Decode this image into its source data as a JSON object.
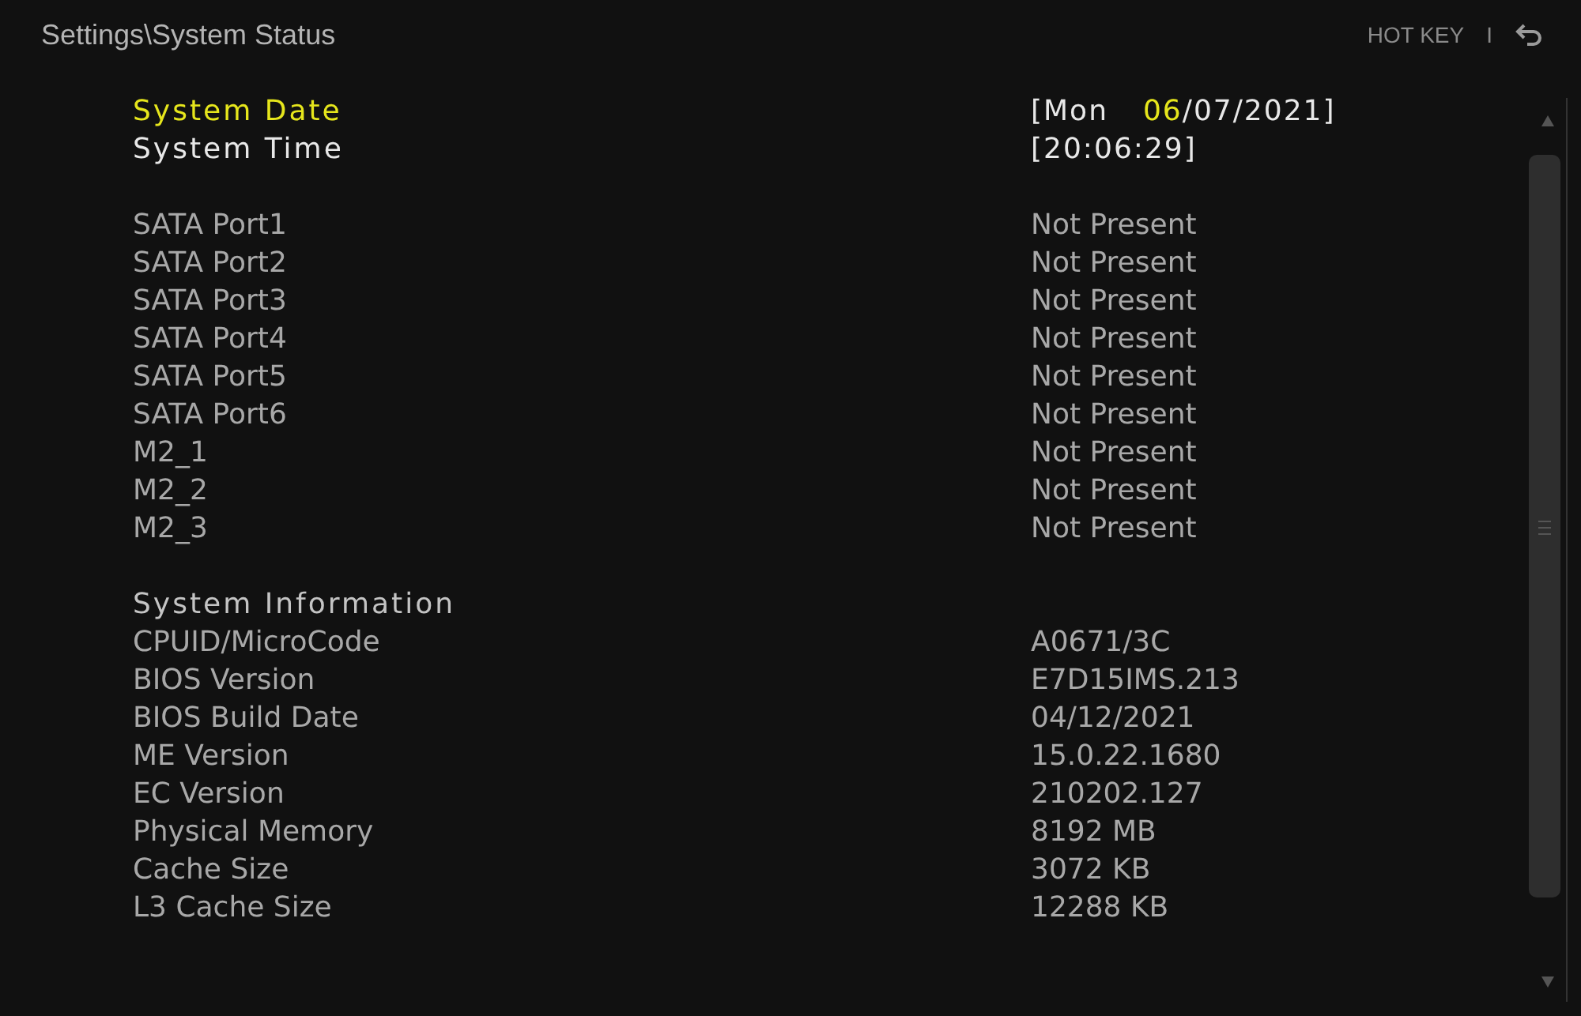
{
  "header": {
    "breadcrumb": "Settings\\System Status",
    "hotkey": "HOT KEY",
    "separator": "I"
  },
  "groups": [
    {
      "rows": [
        {
          "label": "System Date",
          "kind": "editable",
          "selected": true,
          "value_parts": [
            {
              "text": "[Mon",
              "selected": false
            },
            {
              "text": "06",
              "selected": true
            },
            {
              "text": "/07/2021]",
              "selected": false
            }
          ]
        },
        {
          "label": "System Time",
          "kind": "editable",
          "selected": false,
          "value_parts": [
            {
              "text": "[20:06:29]",
              "selected": false
            }
          ]
        }
      ]
    },
    {
      "rows": [
        {
          "label": "SATA Port1",
          "kind": "info",
          "value": "Not Present"
        },
        {
          "label": "SATA Port2",
          "kind": "info",
          "value": "Not Present"
        },
        {
          "label": "SATA Port3",
          "kind": "info",
          "value": "Not Present"
        },
        {
          "label": "SATA Port4",
          "kind": "info",
          "value": "Not Present"
        },
        {
          "label": "SATA Port5",
          "kind": "info",
          "value": "Not Present"
        },
        {
          "label": "SATA Port6",
          "kind": "info",
          "value": "Not Present"
        },
        {
          "label": "M2_1",
          "kind": "info",
          "value": "Not Present"
        },
        {
          "label": "M2_2",
          "kind": "info",
          "value": "Not Present"
        },
        {
          "label": "M2_3",
          "kind": "info",
          "value": "Not Present"
        }
      ]
    },
    {
      "heading": "System Information",
      "rows": [
        {
          "label": "CPUID/MicroCode",
          "kind": "info",
          "value": "A0671/3C"
        },
        {
          "label": "BIOS Version",
          "kind": "info",
          "value": "E7D15IMS.213"
        },
        {
          "label": "BIOS Build Date",
          "kind": "info",
          "value": "04/12/2021"
        },
        {
          "label": "ME Version",
          "kind": "info",
          "value": "15.0.22.1680"
        },
        {
          "label": "EC Version",
          "kind": "info",
          "value": "210202.127"
        },
        {
          "label": "Physical Memory",
          "kind": "info",
          "value": "8192 MB"
        },
        {
          "label": "Cache Size",
          "kind": "info",
          "value": "3072 KB"
        },
        {
          "label": "L3 Cache Size",
          "kind": "info",
          "value": "12288 KB"
        }
      ]
    }
  ]
}
